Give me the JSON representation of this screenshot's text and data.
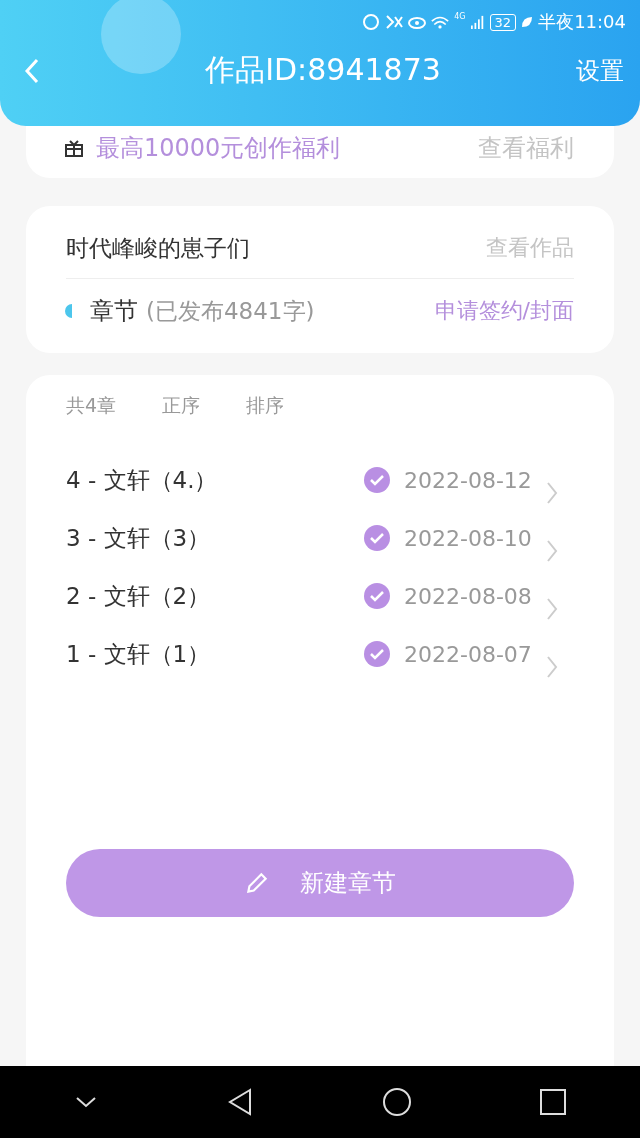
{
  "status_bar": {
    "network": "4G",
    "battery": "32",
    "time": "半夜11:04"
  },
  "header": {
    "title": "作品ID:8941873",
    "settings": "设置"
  },
  "benefit": {
    "text": "最高10000元创作福利",
    "link": "查看福利"
  },
  "work": {
    "title": "时代峰峻的崽子们",
    "link": "查看作品",
    "section": "章节",
    "published": "(已发布4841字)",
    "action": "申请签约/封面"
  },
  "chapters_panel": {
    "count": "共4章",
    "order": "正序",
    "sort": "排序",
    "chapters": [
      {
        "title": "4 - 文轩（4.）",
        "checked": true,
        "date": "2022-08-12"
      },
      {
        "title": "3 - 文轩（3）",
        "checked": true,
        "date": "2022-08-10"
      },
      {
        "title": "2 - 文轩（2）",
        "checked": true,
        "date": "2022-08-08"
      },
      {
        "title": "1 - 文轩（1）",
        "checked": true,
        "date": "2022-08-07"
      }
    ],
    "new_button": "新建章节"
  }
}
